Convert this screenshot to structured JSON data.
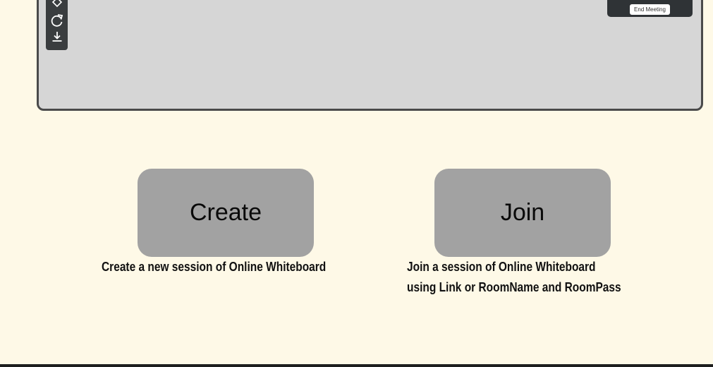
{
  "preview": {
    "toolbar": {
      "icons": [
        "eraser-icon",
        "refresh-icon",
        "download-icon"
      ]
    },
    "end_meeting_label": "End Meeting"
  },
  "actions": {
    "create": {
      "label": "Create",
      "description": "Create a new session of Online Whiteboard"
    },
    "join": {
      "label": "Join",
      "description_line1": "Join a session of Online Whiteboard",
      "description_line2": "using Link or RoomName and RoomPass"
    }
  },
  "colors": {
    "page_background": "#fef9e7",
    "preview_background": "#d6d6d6",
    "toolbar_background": "#3a3d3f",
    "button_background": "#a2a2a2"
  }
}
